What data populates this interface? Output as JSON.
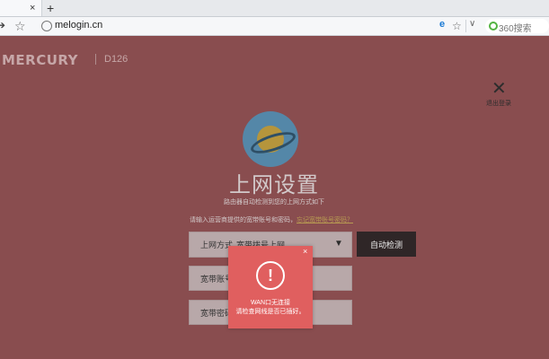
{
  "browser": {
    "tab_close": "×",
    "new_tab": "+",
    "url": "melogin.cn",
    "search_placeholder": "360搜索"
  },
  "brand": {
    "logo": "MERCURY",
    "model": "D126"
  },
  "exit": {
    "label": "退出登录"
  },
  "setup": {
    "title": "上网设置",
    "subtitle": "路由器自动检测到您的上网方式如下",
    "hint": "请输入运营商提供的宽带账号和密码，",
    "hint_link": "忘记宽带账号密码？",
    "connection_label": "上网方式",
    "connection_value": "宽带拨号上网",
    "detect_button": "自动检测",
    "account_label": "宽带账号",
    "password_label": "宽带密码"
  },
  "alert": {
    "close": "×",
    "icon_glyph": "!",
    "line1": "WAN口无连接",
    "line2": "请检查网线是否已插好。"
  },
  "colors": {
    "overlay": "#894d4f",
    "alert_bg": "#e05f5f",
    "button_bg": "#2f2627"
  }
}
